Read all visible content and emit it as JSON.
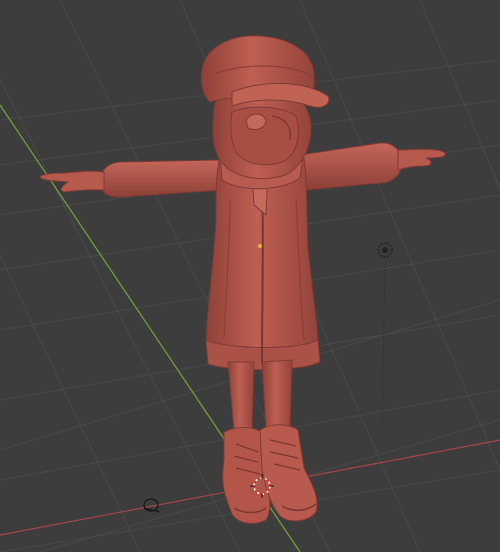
{
  "viewport": {
    "background": "#3d3d3d",
    "grid_color": "#4a4a4a",
    "y_axis_color": "#7aa33b",
    "x_axis_color": "#a8464a",
    "model_color": "#b5574c",
    "model_shadow": "#7f3a33",
    "model_highlight": "#cf7566"
  },
  "objects": {
    "model": "character-model",
    "light": "light-icon",
    "camera": "camera-icon",
    "cursor": "3d-cursor-icon"
  }
}
